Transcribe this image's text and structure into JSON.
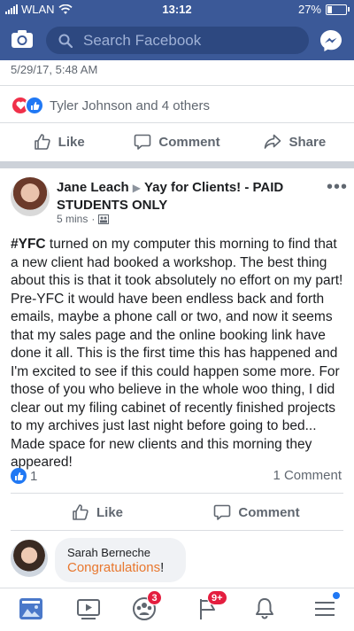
{
  "status_bar": {
    "carrier": "WLAN",
    "time": "13:12",
    "battery": "27%",
    "battery_level": 0.27
  },
  "search": {
    "placeholder": "Search Facebook"
  },
  "post1": {
    "date": "5/29/17, 5:48 AM",
    "reactions_text": "Tyler Johnson and 4 others",
    "actions": {
      "like": "Like",
      "comment": "Comment",
      "share": "Share"
    }
  },
  "post2": {
    "author": "Jane Leach",
    "group": "Yay for Clients! - PAID STUDENTS ONLY",
    "time": "5 mins",
    "hashtag": "#YFC",
    "body": " turned on my computer this morning to find that a new client had booked a workshop. The best thing about this is that it took absolutely no effort on my part! Pre-YFC it would have been endless back and forth emails, maybe a phone call or two, and now it seems that my sales page and the online booking link have done it all. This is the first time this has happened and I'm excited to see if this could happen some more. For those of you who believe in the whole woo thing, I did clear out my filing cabinet of recently finished projects to my archives just last night before going to bed... Made space for new clients and this morning they appeared!",
    "like_count": "1",
    "comment_count": "1 Comment",
    "actions": {
      "like": "Like",
      "comment": "Comment"
    },
    "comment": {
      "name": "Sarah Berneche",
      "text_highlight": "Congratulations",
      "text_suffix": "!"
    }
  },
  "tabbar": {
    "groups_badge": "3",
    "notifications_badge": "9+"
  },
  "colors": {
    "brand": "#3b5998",
    "like_blue": "#2078f4",
    "love_red": "#f0304a",
    "badge_red": "#e41e3f"
  }
}
